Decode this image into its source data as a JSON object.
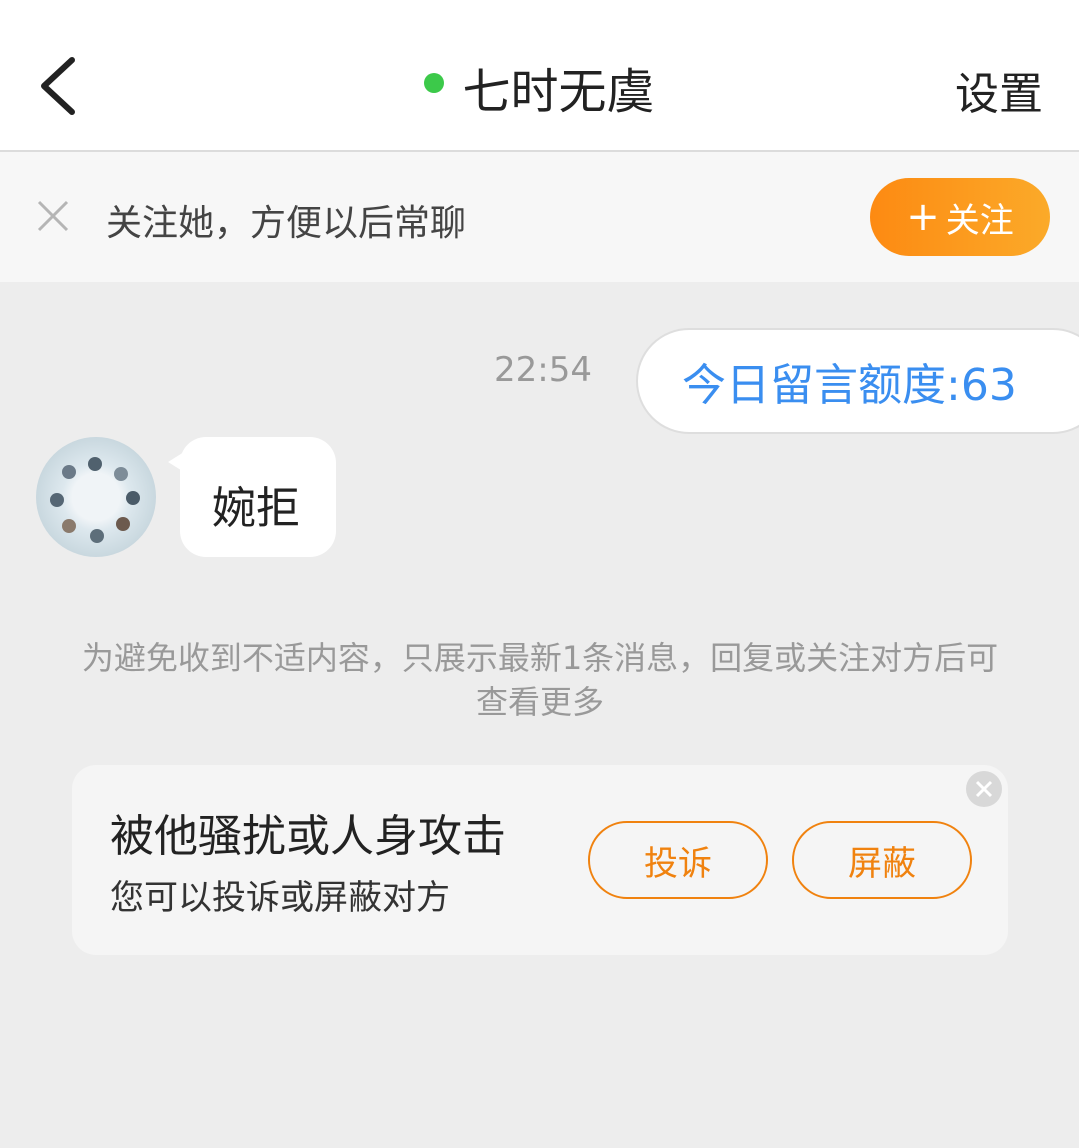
{
  "header": {
    "title": "七时无虞",
    "settings_label": "设置",
    "online_color": "#3cc94a"
  },
  "follow_banner": {
    "text": "关注她，方便以后常聊",
    "follow_label": "关注"
  },
  "messages": {
    "sent": {
      "time": "22:54",
      "text": "今日留言额度:63"
    },
    "received": {
      "text": "婉拒"
    }
  },
  "notice": "为避免收到不适内容，只展示最新1条消息，回复或关注对方后可查看更多",
  "report_card": {
    "title": "被他骚扰或人身攻击",
    "subtitle": "您可以投诉或屏蔽对方",
    "report_label": "投诉",
    "block_label": "屏蔽"
  },
  "colors": {
    "accent_orange": "#f0820f",
    "link_blue": "#3a8ef0"
  }
}
